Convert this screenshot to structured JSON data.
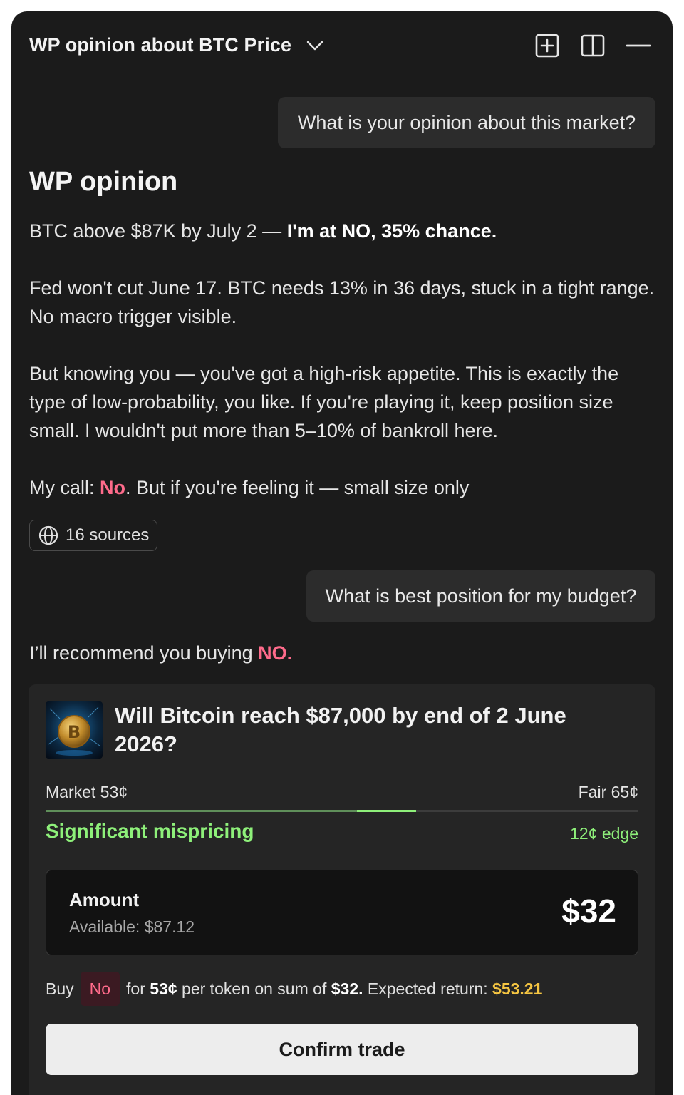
{
  "header": {
    "title": "WP opinion about BTC Price",
    "icons": [
      "chevron-down-icon",
      "new-chat-icon",
      "split-view-icon",
      "minimize-icon"
    ]
  },
  "chat": {
    "user_message_1": "What is your opinion about this market?",
    "reply_heading": "WP opinion",
    "reply_line1_prefix": "BTC above $87K by July 2 — ",
    "reply_line1_bold": "I'm at NO, 35% chance.",
    "reply_para2": "Fed won't cut June 17. BTC needs 13% in 36 days, stuck in a tight range. No macro trigger visible.",
    "reply_para3": "But knowing you — you've got a high-risk appetite. This is exactly the type of low-probability, you like. If you're playing it, keep position size small. I wouldn't put more than 5–10% of bankroll here.",
    "reply_call_prefix": "My call: ",
    "reply_call_no": "No",
    "reply_call_suffix": ". But if you're feeling it — small size only",
    "sources_label": "16 sources",
    "user_message_2": "What is best position for my budget?",
    "recommend_prefix": "I’ll recommend you buying ",
    "recommend_no": "NO."
  },
  "market_card": {
    "title": "Will Bitcoin reach $87,000 by end of 2 June 2026?",
    "market_label": "Market 53¢",
    "fair_label": "Fair 65¢",
    "market_price": 0.53,
    "fair_price": 0.65,
    "mispricing_label": "Significant mispricing",
    "edge_label": "12¢ edge",
    "amount_label": "Amount",
    "available_label": "Available: $87.12",
    "amount_value": "$32",
    "buy_prefix": "Buy",
    "buy_side": "No",
    "buy_for": "for",
    "buy_price": "53¢",
    "buy_mid": "per token on sum of",
    "buy_sum": "$32.",
    "buy_return_label": "Expected return:",
    "buy_return_value": "$53.21",
    "confirm_label": "Confirm trade"
  },
  "colors": {
    "panel_bg": "#1b1b1b",
    "bubble_bg": "#2c2c2c",
    "accent_pink": "#ff6b8b",
    "accent_green": "#8ef07a",
    "accent_gold": "#f5c542"
  }
}
